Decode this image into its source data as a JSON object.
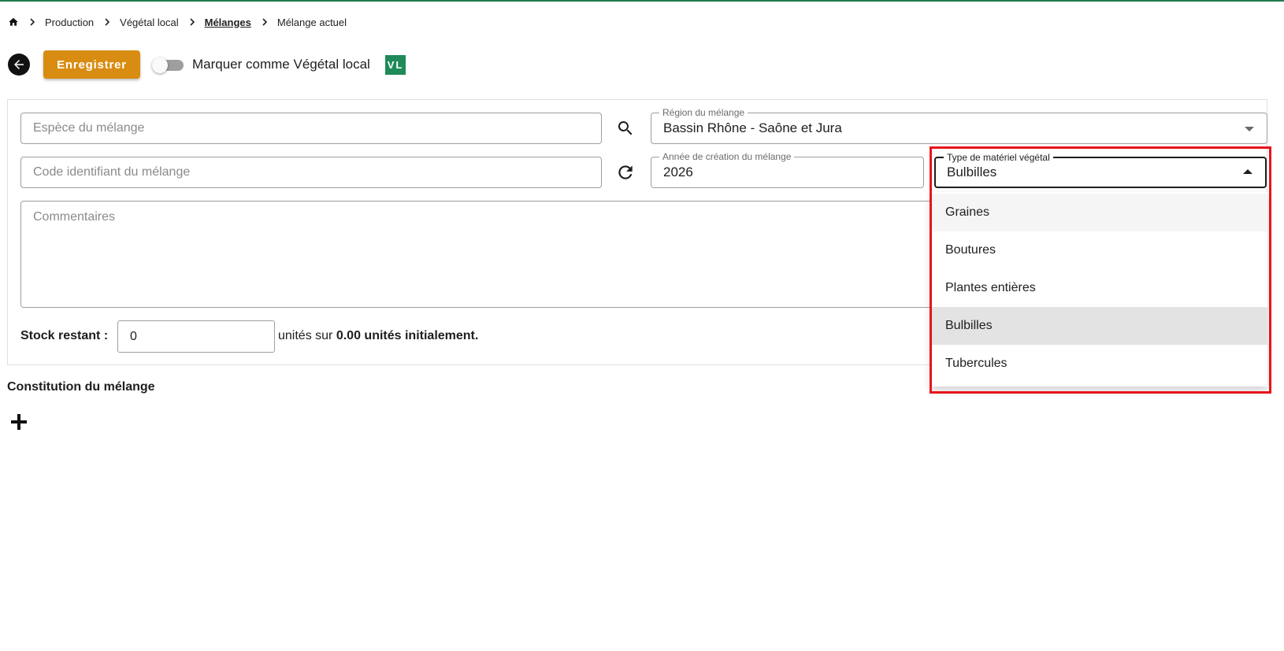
{
  "breadcrumb": {
    "items": [
      "Production",
      "Végétal local",
      "Mélanges",
      "Mélange actuel"
    ]
  },
  "toolbar": {
    "save_label": "Enregistrer",
    "toggle_label": "Marquer comme Végétal local",
    "toggle_on": false,
    "badge": "VL"
  },
  "form": {
    "espece_placeholder": "Espèce du mélange",
    "code_placeholder": "Code identifiant du mélange",
    "region_label": "Région du mélange",
    "region_value": "Bassin Rhône - Saône et Jura",
    "annee_label": "Année de création du mélange",
    "annee_value": "2026",
    "type_label": "Type de matériel végétal",
    "type_value": "Bulbilles",
    "commentaires_placeholder": "Commentaires"
  },
  "stock": {
    "label": "Stock restant :",
    "value": "0",
    "text_prefix": "unités sur",
    "text_bold": "0.00 unités initialement."
  },
  "constitution": {
    "title": "Constitution du mélange"
  },
  "dropdown": {
    "options": [
      "Graines",
      "Boutures",
      "Plantes entières",
      "Bulbilles",
      "Tubercules"
    ],
    "hovered": "Graines",
    "selected": "Bulbilles"
  },
  "colors": {
    "accent_green": "#1f8a5a",
    "save_orange": "#d98c12",
    "highlight_red": "#e8141b"
  },
  "icons": [
    "home-icon",
    "chevron-right-icon",
    "arrow-left-icon",
    "search-icon",
    "refresh-icon",
    "plus-icon",
    "caret-down-icon",
    "caret-up-icon"
  ]
}
